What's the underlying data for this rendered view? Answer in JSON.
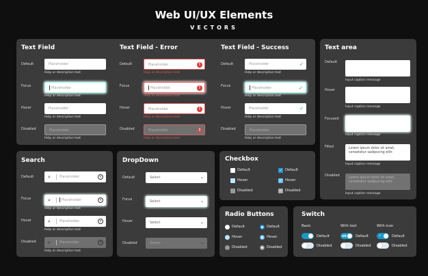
{
  "header": {
    "title": "Web UI/UX Elements",
    "subtitle": "VECTORS"
  },
  "states": {
    "default": "Default",
    "focus": "Focus",
    "hover": "Hover",
    "disabled": "Disabled",
    "focused": "Focused",
    "filled": "Filled"
  },
  "common": {
    "placeholder": "Placeholder",
    "help": "Help or description text",
    "caption": "Input caption message",
    "select": "Select",
    "filled_text": "Lorem ipsum dolor sit amet, consetetur sadipscing elitr."
  },
  "text_field": {
    "title": "Text Field"
  },
  "text_field_error": {
    "title": "Text Field - Error"
  },
  "text_field_success": {
    "title": "Text Field - Success"
  },
  "text_area": {
    "title": "Text area"
  },
  "search": {
    "title": "Search"
  },
  "dropdown": {
    "title": "DropDown"
  },
  "checkbox": {
    "title": "Checkbox"
  },
  "radio": {
    "title": "Radio Buttons"
  },
  "switch": {
    "title": "Switch",
    "basic": "Basic",
    "with_text": "With text",
    "with_icon": "With icon",
    "on_text": "ON",
    "check": "✓"
  },
  "icons": {
    "error": "!",
    "success": "✓",
    "search": "search-icon",
    "clear": "close-icon",
    "chevron": "chevron-down-icon"
  },
  "colors": {
    "background": "#0f0f0f",
    "panel": "#3b3b3b",
    "accent": "#2a96d6",
    "error": "#d63c3c",
    "success": "#2a8f84"
  }
}
